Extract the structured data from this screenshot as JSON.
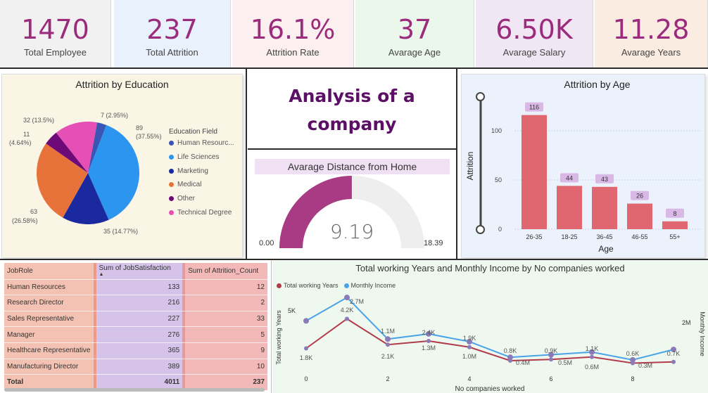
{
  "kpis": [
    {
      "value": "1470",
      "label": "Total Employee",
      "bg": "#f1f1f1"
    },
    {
      "value": "237",
      "label": "Total Attrition",
      "bg": "#e8f1fc"
    },
    {
      "value": "16.1%",
      "label": "Attrition Rate",
      "bg": "#fcefef"
    },
    {
      "value": "37",
      "label": "Avarage Age",
      "bg": "#eaf7ea"
    },
    {
      "value": "6.50K",
      "label": "Avarage Salary",
      "bg": "#f1e6f3"
    },
    {
      "value": "11.28",
      "label": "Avarage Years",
      "bg": "#fbece2"
    }
  ],
  "title_panel": {
    "line1": "Analysis of a",
    "line2": "company"
  },
  "gauge": {
    "title": "Avarage Distance from Home",
    "value": 9.19,
    "value_label": "9.19",
    "min_label": "0.00",
    "max_label": "18.39",
    "min": 0,
    "max": 18.39,
    "fill_color": "#a83b84",
    "track_color": "#eeeeee"
  },
  "education_chart": {
    "title": "Attrition by Education",
    "legend_title": "Education Field",
    "chart_data": {
      "type": "pie",
      "slices": [
        {
          "name": "Human Resourc...",
          "value": 7,
          "label": "7 (2.95%)",
          "color": "#3a55b4"
        },
        {
          "name": "Life Sciences",
          "value": 89,
          "label": "89 (37.55%)",
          "color": "#2b95f0"
        },
        {
          "name": "Marketing",
          "value": 35,
          "label": "35 (14.77%)",
          "color": "#1a2a9e"
        },
        {
          "name": "Medical",
          "value": 63,
          "label": "63 (26.58%)",
          "color": "#e8733a"
        },
        {
          "name": "Other",
          "value": 11,
          "label": "11 (4.64%)",
          "color": "#6d0a78"
        },
        {
          "name": "Technical Degree",
          "value": 32,
          "label": "32 (13.5%)",
          "color": "#e54fb6"
        }
      ]
    },
    "pie_labels": {
      "hr_a": "7 (2.95%)",
      "ls_a": "89",
      "ls_b": "(37.55%)",
      "mk_a": "35 (14.77%)",
      "md_a": "63",
      "md_b": "(26.58%)",
      "ot_a": "11",
      "ot_b": "(4.64%)",
      "td_a": "32 (13.5%)"
    }
  },
  "age_chart": {
    "title": "Attrition by Age",
    "chart_data": {
      "type": "bar",
      "categories": [
        "26-35",
        "18-25",
        "36-45",
        "46-55",
        "55+"
      ],
      "values": [
        116,
        44,
        43,
        26,
        8
      ],
      "xlabel": "Age",
      "ylabel": "Attrition",
      "ylim": [
        0,
        125
      ],
      "yticks": [
        0,
        50,
        100
      ],
      "bar_color": "#e06670",
      "label_bg": "#d9b8e6"
    }
  },
  "job_table": {
    "headers": [
      "JobRole",
      "Sum of JobSatisfaction",
      "Sum of Attrition_Count"
    ],
    "rows": [
      [
        "Human Resources",
        "133",
        "12"
      ],
      [
        "Research Director",
        "216",
        "2"
      ],
      [
        "Sales Representative",
        "227",
        "33"
      ],
      [
        "Manager",
        "276",
        "5"
      ],
      [
        "Healthcare Representative",
        "365",
        "9"
      ],
      [
        "Manufacturing Director",
        "389",
        "10"
      ]
    ],
    "total": [
      "Total",
      "4011",
      "237"
    ]
  },
  "line_chart": {
    "title": "Total working Years and Monthly Income by No companies worked",
    "chart_data": {
      "type": "line",
      "x": [
        0,
        1,
        2,
        3,
        4,
        5,
        6,
        7,
        8,
        9
      ],
      "xticks": [
        0,
        2,
        4,
        6,
        8
      ],
      "xlabel": "No companies worked",
      "ylabel_left": "Total working Years",
      "ylabel_right": "Monthly Income",
      "left_ticks": [
        {
          "v": 5000,
          "label": "5K"
        }
      ],
      "right_ticks": [
        {
          "v": 2000000,
          "label": "2M"
        }
      ],
      "series": [
        {
          "name": "Total working Years",
          "color": "#b33a4a",
          "values": [
            1.8,
            4.2,
            2.1,
            2.4,
            1.9,
            0.8,
            0.9,
            1.1,
            0.6,
            0.7
          ]
        },
        {
          "name": "Monthly Income",
          "color": "#4aa3e8",
          "values": [
            1.8,
            2.7,
            1.1,
            1.3,
            1.0,
            0.4,
            0.5,
            0.6,
            0.3,
            0.7
          ]
        }
      ],
      "labels": [
        "1.8K",
        "4.2K",
        "2.7M",
        "1.1M",
        "2.1K",
        "2.4K",
        "1.3M",
        "1.9K",
        "1.0M",
        "0.8K",
        "0.4M",
        "0.9K",
        "0.5M",
        "1.1K",
        "0.6M",
        "0.6K",
        "0.3M",
        "0.7K"
      ]
    }
  }
}
